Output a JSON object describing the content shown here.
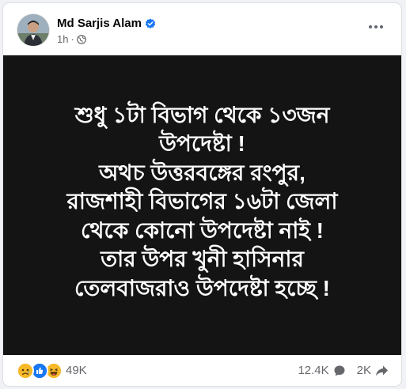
{
  "post": {
    "author": "Md Sarjis Alam",
    "time": "1h",
    "more_icon": "more-horizontal-icon",
    "lines": [
      "শুধু ১টা বিভাগ থেকে ১৩জন",
      "উপদেষ্টা !",
      "অথচ উত্তরবঙ্গের রংপুর,",
      "রাজশাহী বিভাগের ১৬টা জেলা",
      "থেকে কোনো উপদেষ্টা নাই !",
      "তার উপর খুনী হাসিনার",
      "তেলবাজরাও উপদেষ্টা হচ্ছে !"
    ]
  },
  "footer": {
    "reactions": [
      "sad",
      "like",
      "haha"
    ],
    "reaction_count": "49K",
    "comment_count": "12.4K",
    "share_count": "2K"
  },
  "colors": {
    "image_background": "#141414",
    "like_blue": "#1877f2",
    "emoji_yellow": "#f7b928"
  }
}
